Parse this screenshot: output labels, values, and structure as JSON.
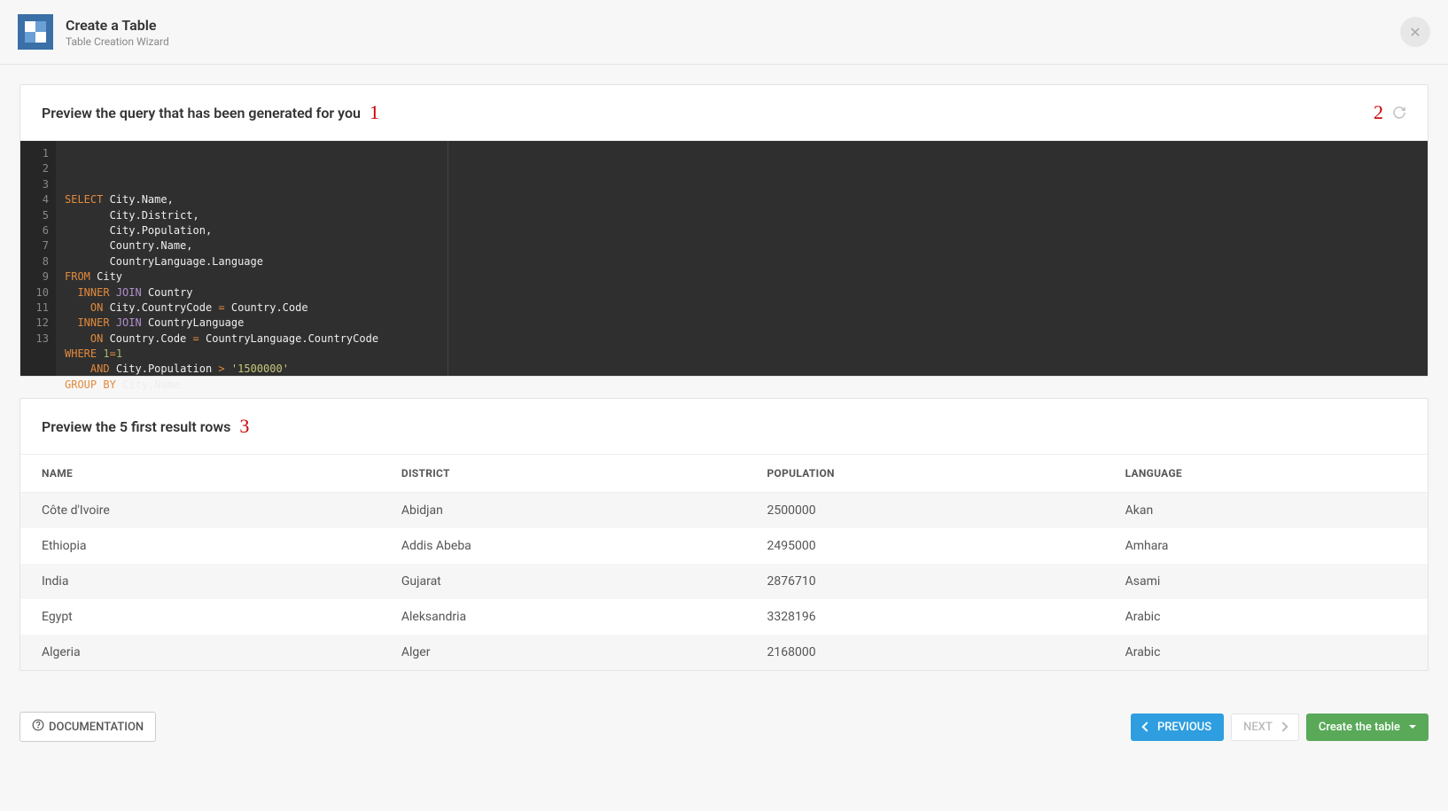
{
  "header": {
    "title": "Create a Table",
    "subtitle": "Table Creation Wizard"
  },
  "annotations": {
    "one": "1",
    "two": "2",
    "three": "3"
  },
  "query_panel": {
    "title": "Preview the query that has been generated for you"
  },
  "code": {
    "line_count": 13,
    "tokens": [
      [
        {
          "t": "SELECT",
          "c": "kw"
        },
        {
          "t": " City.Name,",
          "c": "ident"
        }
      ],
      [
        {
          "t": "       City.District,",
          "c": "ident"
        }
      ],
      [
        {
          "t": "       City.Population,",
          "c": "ident"
        }
      ],
      [
        {
          "t": "       Country.Name,",
          "c": "ident"
        }
      ],
      [
        {
          "t": "       CountryLanguage.Language",
          "c": "ident"
        }
      ],
      [
        {
          "t": "FROM",
          "c": "kw"
        },
        {
          "t": " City",
          "c": "ident"
        }
      ],
      [
        {
          "t": "  ",
          "c": "ident"
        },
        {
          "t": "INNER",
          "c": "kw"
        },
        {
          "t": " ",
          "c": "ident"
        },
        {
          "t": "JOIN",
          "c": "kw2"
        },
        {
          "t": " Country",
          "c": "ident"
        }
      ],
      [
        {
          "t": "    ",
          "c": "ident"
        },
        {
          "t": "ON",
          "c": "kw"
        },
        {
          "t": " City.CountryCode ",
          "c": "ident"
        },
        {
          "t": "=",
          "c": "kw"
        },
        {
          "t": " Country.Code",
          "c": "ident"
        }
      ],
      [
        {
          "t": "  ",
          "c": "ident"
        },
        {
          "t": "INNER",
          "c": "kw"
        },
        {
          "t": " ",
          "c": "ident"
        },
        {
          "t": "JOIN",
          "c": "kw2"
        },
        {
          "t": " CountryLanguage",
          "c": "ident"
        }
      ],
      [
        {
          "t": "    ",
          "c": "ident"
        },
        {
          "t": "ON",
          "c": "kw"
        },
        {
          "t": " Country.Code ",
          "c": "ident"
        },
        {
          "t": "=",
          "c": "kw"
        },
        {
          "t": " CountryLanguage.CountryCode",
          "c": "ident"
        }
      ],
      [
        {
          "t": "WHERE",
          "c": "kw"
        },
        {
          "t": " ",
          "c": "ident"
        },
        {
          "t": "1",
          "c": "num"
        },
        {
          "t": "=",
          "c": "kw"
        },
        {
          "t": "1",
          "c": "num"
        }
      ],
      [
        {
          "t": "    ",
          "c": "ident"
        },
        {
          "t": "AND",
          "c": "kw"
        },
        {
          "t": " City.Population ",
          "c": "ident"
        },
        {
          "t": ">",
          "c": "kw"
        },
        {
          "t": " ",
          "c": "ident"
        },
        {
          "t": "'1500000'",
          "c": "str"
        }
      ],
      [
        {
          "t": "GROUP BY",
          "c": "kw"
        },
        {
          "t": " City.Name",
          "c": "ident"
        }
      ]
    ]
  },
  "results_panel": {
    "title": "Preview the 5 first result rows",
    "columns": [
      "NAME",
      "DISTRICT",
      "POPULATION",
      "LANGUAGE"
    ],
    "rows": [
      {
        "name": "Côte d'Ivoire",
        "district": "Abidjan",
        "population": "2500000",
        "language": "Akan"
      },
      {
        "name": "Ethiopia",
        "district": "Addis Abeba",
        "population": "2495000",
        "language": "Amhara"
      },
      {
        "name": "India",
        "district": "Gujarat",
        "population": "2876710",
        "language": "Asami"
      },
      {
        "name": "Egypt",
        "district": "Aleksandria",
        "population": "3328196",
        "language": "Arabic"
      },
      {
        "name": "Algeria",
        "district": "Alger",
        "population": "2168000",
        "language": "Arabic"
      }
    ]
  },
  "footer": {
    "documentation": "DOCUMENTATION",
    "previous": "PREVIOUS",
    "next": "NEXT",
    "create": "Create the table"
  }
}
